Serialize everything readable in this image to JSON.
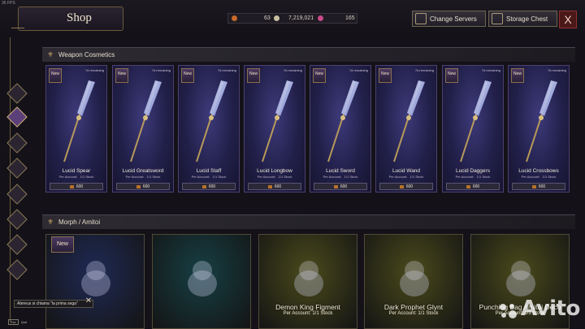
{
  "fps": "35 FPS",
  "header": {
    "title": "Shop"
  },
  "currencies": [
    {
      "name": "red-token",
      "value": "63",
      "color": "#c86a2a"
    },
    {
      "name": "silver-coin",
      "value": "7,219,021",
      "color": "#c8c0a0"
    },
    {
      "name": "pink-gem",
      "value": "165",
      "color": "#c84a8a"
    }
  ],
  "buttons": {
    "change_servers": "Change Servers",
    "storage_chest": "Storage Chest",
    "close": "X"
  },
  "sections": {
    "weapon": "Weapon Cosmetics",
    "morph": "Morph / Amitoi"
  },
  "weapon_cards": [
    {
      "name": "Lucid Spear",
      "new": "New",
      "remaining": "7d remaining",
      "account": "Per Account:",
      "stock": "1/1 Stock",
      "price": "600"
    },
    {
      "name": "Lucid Greatsword",
      "new": "New",
      "remaining": "7d remaining",
      "account": "Per Account:",
      "stock": "1/1 Stock",
      "price": "600"
    },
    {
      "name": "Lucid Staff",
      "new": "New",
      "remaining": "7d remaining",
      "account": "Per Account:",
      "stock": "1/1 Stock",
      "price": "600"
    },
    {
      "name": "Lucid Longbow",
      "new": "New",
      "remaining": "7d remaining",
      "account": "Per Account:",
      "stock": "1/1 Stock",
      "price": "600"
    },
    {
      "name": "Lucid Sword",
      "new": "New",
      "remaining": "7d remaining",
      "account": "Per Account:",
      "stock": "1/1 Stock",
      "price": "600"
    },
    {
      "name": "Lucid Wand",
      "new": "New",
      "remaining": "7d remaining",
      "account": "Per Account:",
      "stock": "1/1 Stock",
      "price": "600"
    },
    {
      "name": "Lucid Daggers",
      "new": "New",
      "remaining": "7d remaining",
      "account": "Per Account:",
      "stock": "1/1 Stock",
      "price": "600"
    },
    {
      "name": "Lucid Crossbows",
      "new": "New",
      "remaining": "7d remaining",
      "account": "Per Account:",
      "stock": "1/1 Stock",
      "price": "600"
    }
  ],
  "morph_cards": [
    {
      "name": "",
      "new": "New",
      "stock": "",
      "bg": "#1f2a55"
    },
    {
      "name": "",
      "new": "",
      "stock": "",
      "bg": "#163f44"
    },
    {
      "name": "Demon King Figment",
      "new": "",
      "stock": "Per Account: 1/1 Stock",
      "bg": "#4a4a1c"
    },
    {
      "name": "Dark Prophet Glynt",
      "new": "",
      "stock": "Per Account: 1/1 Stock",
      "bg": "#4a4a1c"
    },
    {
      "name": "Punching Bag Amitoi Deco",
      "new": "",
      "stock": "Per Account: 1/1 Stock",
      "bg": "#4a4a1c"
    }
  ],
  "tooltip": {
    "text": "Atereus  si chiama \"la prima sega\"",
    "close": "✕"
  },
  "footer": {
    "key": "Esc",
    "label": "Quit"
  },
  "watermark": "Avito"
}
